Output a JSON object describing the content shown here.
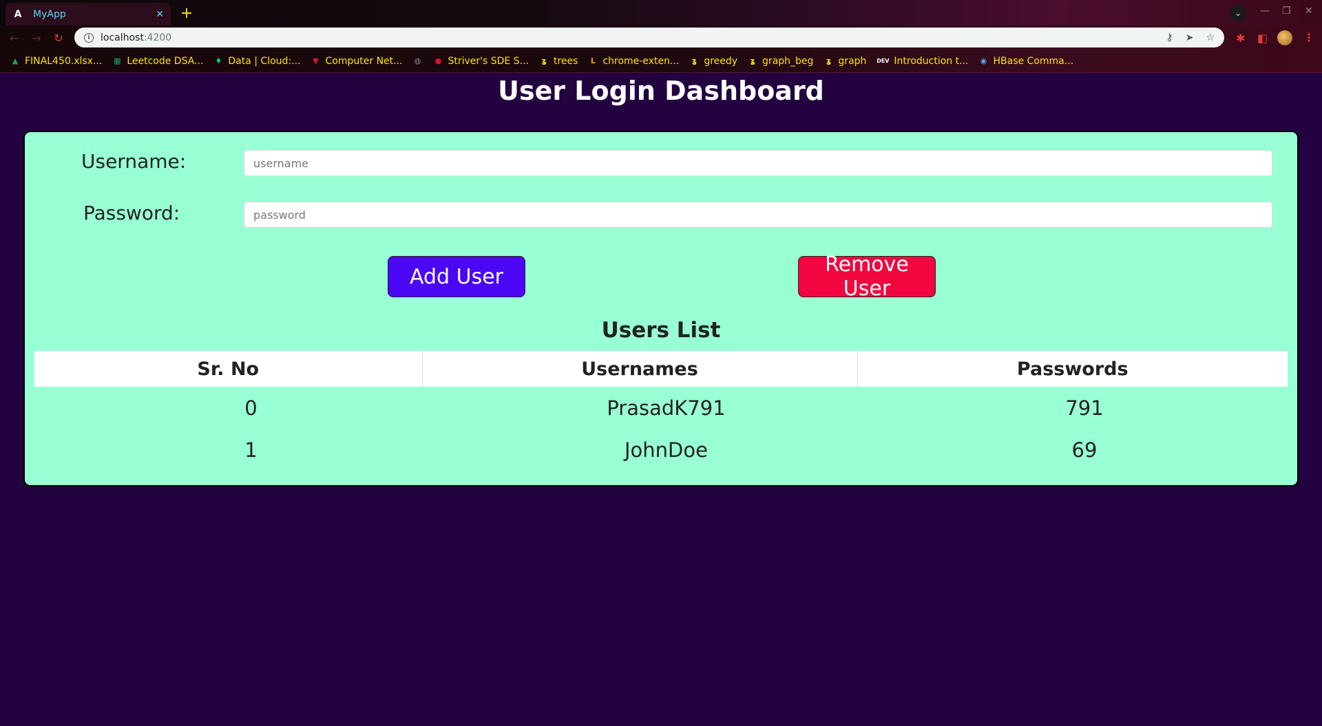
{
  "browser": {
    "tab": {
      "title": "MyApp",
      "favicon": "A",
      "close": "✕"
    },
    "new_tab": "+",
    "omnibox": {
      "host": "localhost",
      "port": ":4200"
    },
    "bookmarks": [
      {
        "label": "FINAL450.xlsx...",
        "icon": "drive-icon",
        "color": "#2f9e44"
      },
      {
        "label": "Leetcode DSA...",
        "icon": "sheets-icon",
        "color": "#1aa260"
      },
      {
        "label": "Data | Cloud:...",
        "icon": "leaf-icon",
        "color": "#00d084"
      },
      {
        "label": "Computer Net...",
        "icon": "v-icon",
        "color": "#e0112b"
      },
      {
        "label": "",
        "icon": "globe-icon",
        "color": "#888888"
      },
      {
        "label": "Striver's SDE S...",
        "icon": "tuf-icon",
        "color": "#e0112b"
      },
      {
        "label": "trees",
        "icon": "g-icon",
        "color": "#ffe600"
      },
      {
        "label": "chrome-exten...",
        "icon": "lk-icon",
        "color": "#f59f00"
      },
      {
        "label": "greedy",
        "icon": "g-icon",
        "color": "#ffe600"
      },
      {
        "label": "graph_beg",
        "icon": "g-icon",
        "color": "#ffe600"
      },
      {
        "label": "graph",
        "icon": "g-icon",
        "color": "#ffe600"
      },
      {
        "label": "Introduction t...",
        "icon": "dev-icon",
        "color": "#ffffff"
      },
      {
        "label": "HBase Comma...",
        "icon": "hbase-icon",
        "color": "#4dabf7"
      }
    ]
  },
  "page": {
    "title": "User Login Dashboard",
    "form": {
      "username_label": "Username:",
      "username_placeholder": "username",
      "password_label": "Password:",
      "password_placeholder": "password"
    },
    "buttons": {
      "add": "Add User",
      "remove": "Remove User"
    },
    "users_list": {
      "title": "Users List",
      "headers": [
        "Sr. No",
        "Usernames",
        "Passwords"
      ],
      "rows": [
        [
          "0",
          "PrasadK791",
          "791"
        ],
        [
          "1",
          "JohnDoe",
          "69"
        ]
      ]
    }
  },
  "colors": {
    "page_bg": "#22023f",
    "card_bg": "#99ffd5",
    "add_button": "#4b07f6",
    "remove_button": "#f2063f",
    "bookmark_text": "#ffe600"
  }
}
